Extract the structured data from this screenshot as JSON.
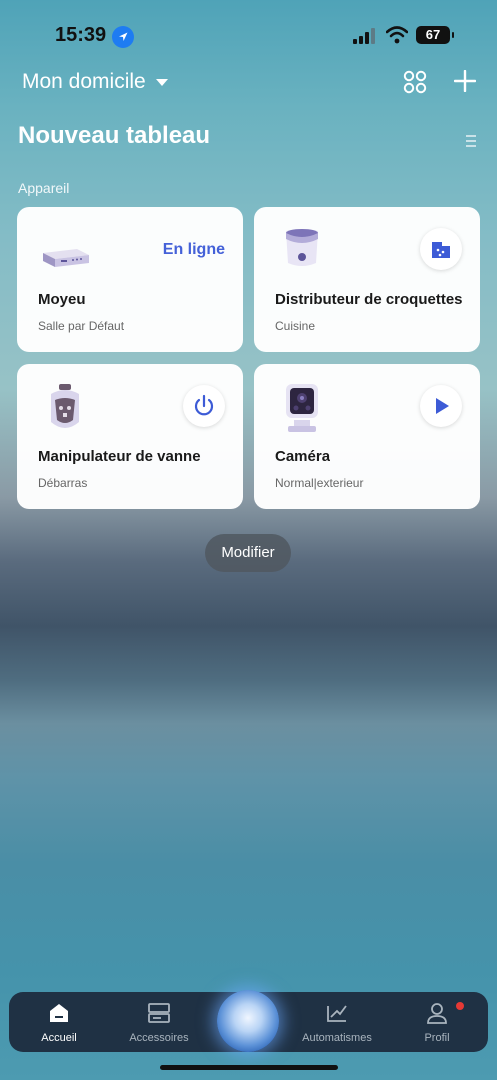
{
  "status_bar": {
    "time": "15:39",
    "battery": "67"
  },
  "header": {
    "home_name": "Mon domicile"
  },
  "board": {
    "title": "Nouveau tableau",
    "section_label": "Appareil"
  },
  "devices": [
    {
      "name": "Moyeu",
      "room": "Salle par Défaut",
      "status": "En ligne"
    },
    {
      "name": "Distributeur de croquettes",
      "room": "Cuisine",
      "action_icon": "feed-icon"
    },
    {
      "name": "Manipulateur de vanne",
      "room": "Débarras",
      "action_icon": "power-icon"
    },
    {
      "name": "Caméra",
      "room": "Normal|exterieur",
      "action_icon": "play-icon"
    }
  ],
  "modify_label": "Modifier",
  "tabbar": {
    "home": "Accueil",
    "accessories": "Accessoires",
    "automations": "Automatismes",
    "profile": "Profil"
  },
  "colors": {
    "accent": "#4461d8",
    "tabbar": "#1f3144"
  }
}
